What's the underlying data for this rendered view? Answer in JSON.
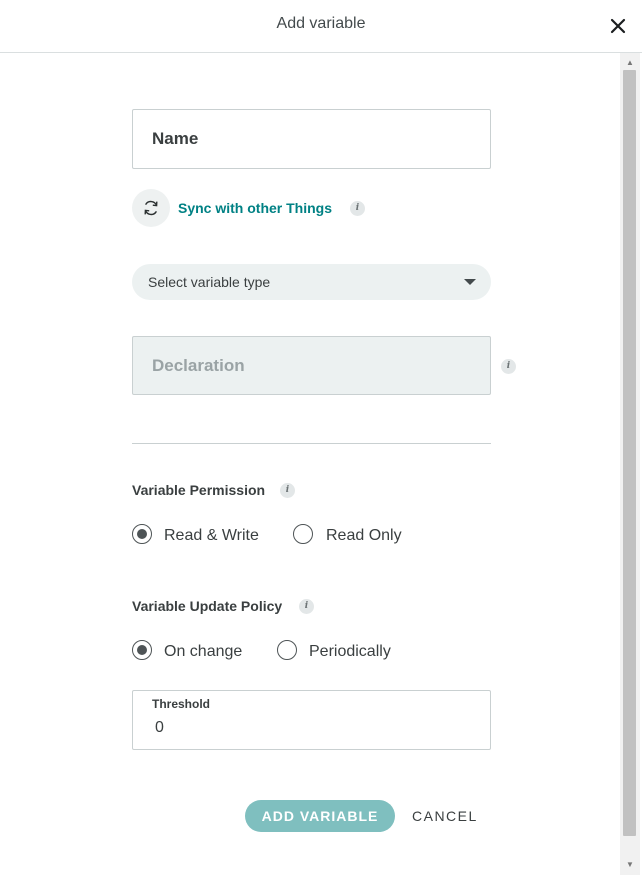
{
  "dialog": {
    "title": "Add variable",
    "close_icon": "close-icon"
  },
  "form": {
    "name_placeholder": "Name",
    "sync_label": "Sync with other Things",
    "sync_icon": "sync-icon",
    "info_glyph": "i",
    "variable_type_placeholder": "Select variable type",
    "declaration_placeholder": "Declaration"
  },
  "permission": {
    "title": "Variable Permission",
    "options": [
      "Read & Write",
      "Read Only"
    ],
    "selected": "Read & Write"
  },
  "update_policy": {
    "title": "Variable Update Policy",
    "options": [
      "On change",
      "Periodically"
    ],
    "selected": "On change"
  },
  "threshold": {
    "label": "Threshold",
    "value": "0"
  },
  "actions": {
    "add_label": "ADD VARIABLE",
    "cancel_label": "CANCEL"
  },
  "colors": {
    "accent": "#008184",
    "add_button": "#7fbfbf",
    "field_fill": "#ecf1f1"
  }
}
